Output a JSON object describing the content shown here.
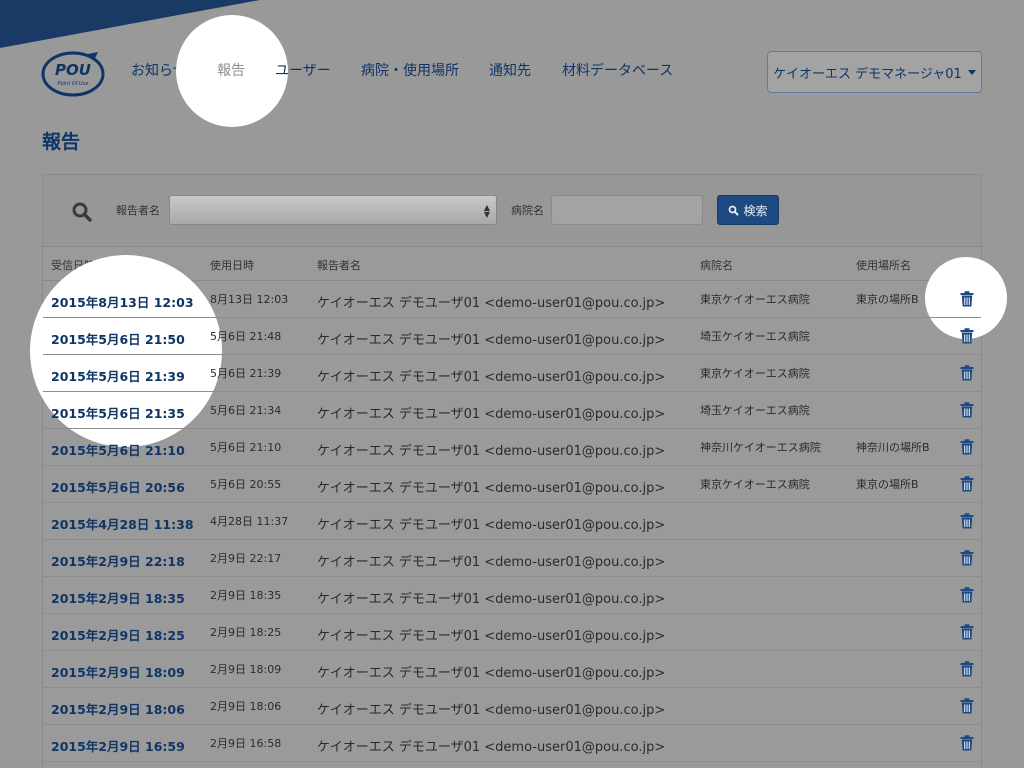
{
  "colors": {
    "page_background": "#999999",
    "brand_navy": "#0f3566",
    "corner_band": "#1a3a66",
    "button_primary": "#1d4a80",
    "highlight": "#ffffff"
  },
  "logo": {
    "text": "POU",
    "tagline": "Point Of Use"
  },
  "nav": {
    "items": [
      {
        "label": "お知らせ"
      },
      {
        "label": "報告",
        "active": true
      },
      {
        "label": "ユーザー"
      },
      {
        "label": "病院・使用場所"
      },
      {
        "label": "通知先"
      },
      {
        "label": "材料データベース"
      }
    ],
    "user_menu_label": "ケイオーエス デモマネージャ01"
  },
  "page": {
    "title": "報告"
  },
  "filters": {
    "search_icon": "search-icon",
    "reporter_label": "報告者名",
    "reporter_selected": "",
    "hospital_label": "病院名",
    "hospital_value": "",
    "search_button_label": "検索"
  },
  "table": {
    "headers": {
      "received": "受信日時",
      "used": "使用日時",
      "reporter": "報告者名",
      "hospital": "病院名",
      "place": "使用場所名"
    },
    "delete_icon": "trash-icon",
    "rows": [
      {
        "received": "2015年8月13日 12:03",
        "used": "8月13日 12:03",
        "reporter": "ケイオーエス デモユーザ01 <demo-user01@pou.co.jp>",
        "hospital": "東京ケイオーエス病院",
        "place": "東京の場所B"
      },
      {
        "received": "2015年5月6日 21:50",
        "used": "5月6日 21:48",
        "reporter": "ケイオーエス デモユーザ01 <demo-user01@pou.co.jp>",
        "hospital": "埼玉ケイオーエス病院",
        "place": ""
      },
      {
        "received": "2015年5月6日 21:39",
        "used": "5月6日 21:39",
        "reporter": "ケイオーエス デモユーザ01 <demo-user01@pou.co.jp>",
        "hospital": "東京ケイオーエス病院",
        "place": ""
      },
      {
        "received": "2015年5月6日 21:35",
        "used": "5月6日 21:34",
        "reporter": "ケイオーエス デモユーザ01 <demo-user01@pou.co.jp>",
        "hospital": "埼玉ケイオーエス病院",
        "place": ""
      },
      {
        "received": "2015年5月6日 21:10",
        "used": "5月6日 21:10",
        "reporter": "ケイオーエス デモユーザ01 <demo-user01@pou.co.jp>",
        "hospital": "神奈川ケイオーエス病院",
        "place": "神奈川の場所B"
      },
      {
        "received": "2015年5月6日 20:56",
        "used": "5月6日 20:55",
        "reporter": "ケイオーエス デモユーザ01 <demo-user01@pou.co.jp>",
        "hospital": "東京ケイオーエス病院",
        "place": "東京の場所B"
      },
      {
        "received": "2015年4月28日 11:38",
        "used": "4月28日 11:37",
        "reporter": "ケイオーエス デモユーザ01 <demo-user01@pou.co.jp>",
        "hospital": "",
        "place": ""
      },
      {
        "received": "2015年2月9日 22:18",
        "used": "2月9日 22:17",
        "reporter": "ケイオーエス デモユーザ01 <demo-user01@pou.co.jp>",
        "hospital": "",
        "place": ""
      },
      {
        "received": "2015年2月9日 18:35",
        "used": "2月9日 18:35",
        "reporter": "ケイオーエス デモユーザ01 <demo-user01@pou.co.jp>",
        "hospital": "",
        "place": ""
      },
      {
        "received": "2015年2月9日 18:25",
        "used": "2月9日 18:25",
        "reporter": "ケイオーエス デモユーザ01 <demo-user01@pou.co.jp>",
        "hospital": "",
        "place": ""
      },
      {
        "received": "2015年2月9日 18:09",
        "used": "2月9日 18:09",
        "reporter": "ケイオーエス デモユーザ01 <demo-user01@pou.co.jp>",
        "hospital": "",
        "place": ""
      },
      {
        "received": "2015年2月9日 18:06",
        "used": "2月9日 18:06",
        "reporter": "ケイオーエス デモユーザ01 <demo-user01@pou.co.jp>",
        "hospital": "",
        "place": ""
      },
      {
        "received": "2015年2月9日 16:59",
        "used": "2月9日 16:58",
        "reporter": "ケイオーエス デモユーザ01 <demo-user01@pou.co.jp>",
        "hospital": "",
        "place": ""
      }
    ]
  }
}
